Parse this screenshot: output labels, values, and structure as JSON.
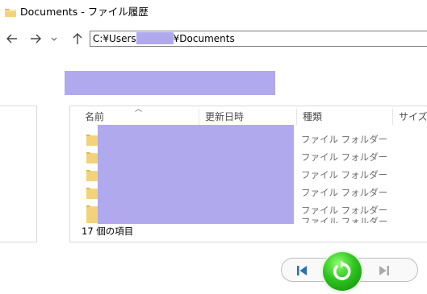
{
  "window": {
    "title": "Documents - ファイル履歴"
  },
  "addressbar": {
    "path_prefix": "C:¥Users",
    "path_suffix": "¥Documents"
  },
  "file_list": {
    "columns": [
      "名前",
      "更新日時",
      "種類",
      "サイズ"
    ],
    "rows": [
      {
        "type": "ファイル フォルダー"
      },
      {
        "type": "ファイル フォルダー"
      },
      {
        "type": "ファイル フォルダー"
      },
      {
        "type": "ファイル フォルダー"
      },
      {
        "type": "ファイル フォルダー"
      }
    ],
    "partial_row_type": "ファイル フォルダー",
    "status": "17 個の項目"
  },
  "icons": {
    "title": "folder-icon",
    "back": "arrow-left-icon",
    "forward": "arrow-right-icon",
    "history": "chevron-down-icon",
    "up": "arrow-up-icon",
    "row": "folder-icon",
    "previous": "skip-previous-icon",
    "restore": "restore-icon",
    "next": "skip-next-icon"
  },
  "colors": {
    "redaction": "#b0a9ee",
    "folder": "#f3d37a",
    "restore_green": "#2fc41f",
    "media_blue": "#2a6fb0"
  }
}
